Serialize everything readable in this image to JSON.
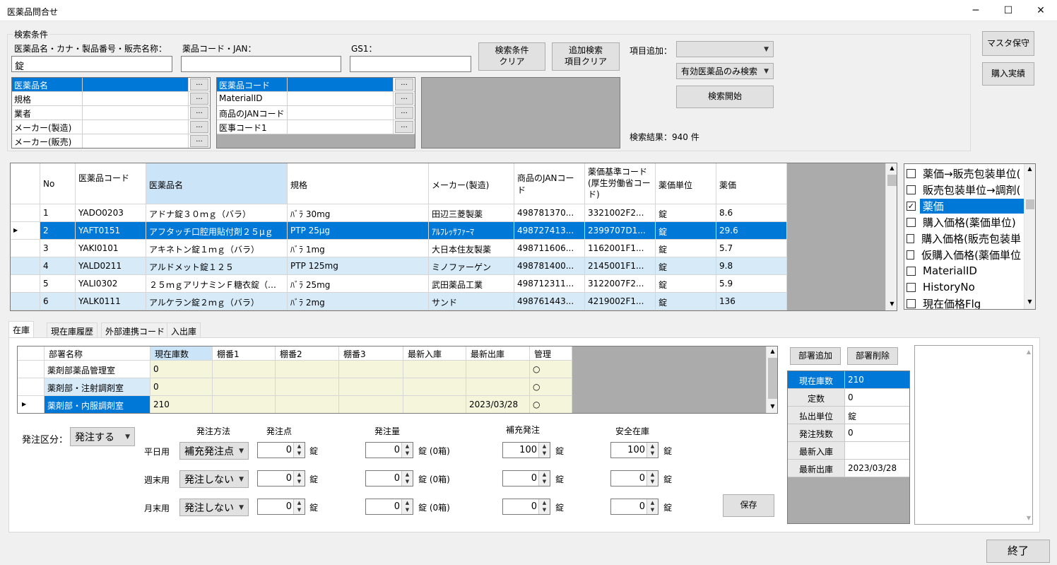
{
  "window": {
    "title": "医薬品問合せ",
    "minimize": "─",
    "maximize": "☐",
    "close": "✕"
  },
  "search": {
    "group_label": "検索条件",
    "name_label": "医薬品名・カナ・製品番号・販売名称：",
    "name_value": "錠",
    "code_label": "薬品コード・JAN：",
    "code_value": "",
    "gs1_label": "GS1：",
    "gs1_value": "",
    "clear_btn": [
      "検索条件",
      "クリア"
    ],
    "add_clear_btn": [
      "追加検索",
      "項目クリア"
    ],
    "add_item_label": "項目追加：",
    "add_item_value": "",
    "filter_value": "有効医薬品のみ検索",
    "start_btn": "検索開始",
    "result_text": "検索結果：940 件",
    "list1": [
      "医薬品名",
      "規格",
      "業者",
      "メーカー(製造)",
      "メーカー(販売)"
    ],
    "list2": [
      "医薬品コード",
      "MaterialID",
      "商品のJANコード",
      "医事コード1"
    ],
    "ellipsis": "..."
  },
  "side_buttons": {
    "master": "マスタ保守",
    "purchase": "購入実績"
  },
  "drug_grid": {
    "headers": [
      "No",
      "医薬品コード",
      "医薬品名",
      "規格",
      "メーカー(製造)",
      "商品のJANコード",
      "薬価基準コード(厚生労働省コード)",
      "薬価単位",
      "薬価"
    ],
    "rows": [
      [
        "1",
        "YADO0203",
        "アドナ錠３０ｍｇ（バラ）",
        "ﾊﾞﾗ 30mg",
        "田辺三菱製薬",
        "498781370...",
        "3321002F2...",
        "錠",
        "8.6"
      ],
      [
        "2",
        "YAFT0151",
        "アフタッチ口腔用貼付剤２５μｇ",
        "PTP 25μg",
        "ｱﾙﾌﾚｯｻﾌｧｰﾏ",
        "498727413...",
        "2399707D1...",
        "錠",
        "29.6"
      ],
      [
        "3",
        "YAKI0101",
        "アキネトン錠１ｍｇ（バラ）",
        "ﾊﾞﾗ 1mg",
        "大日本住友製薬",
        "498711606...",
        "1162001F1...",
        "錠",
        "5.7"
      ],
      [
        "4",
        "YALD0211",
        "アルドメット錠１２５",
        "PTP 125mg",
        "ミノファーゲン",
        "498781400...",
        "2145001F1...",
        "錠",
        "9.8"
      ],
      [
        "5",
        "YALI0302",
        "２５ｍｇアリナミンＦ糖衣錠（バ...",
        "ﾊﾞﾗ 25mg",
        "武田薬品工業",
        "498712311...",
        "3122007F2...",
        "錠",
        "5.9"
      ],
      [
        "6",
        "YALK0111",
        "アルケラン錠２ｍｇ（バラ）",
        "ﾊﾞﾗ 2mg",
        "サンド",
        "498761443...",
        "4219002F1...",
        "錠",
        "136"
      ]
    ]
  },
  "column_checklist": [
    {
      "label": "薬価→販売包装単位(",
      "checked": false
    },
    {
      "label": "販売包装単位→調剤(",
      "checked": false
    },
    {
      "label": "薬価",
      "checked": true
    },
    {
      "label": "購入価格(薬価単位)",
      "checked": false
    },
    {
      "label": "購入価格(販売包装単",
      "checked": false
    },
    {
      "label": "仮購入価格(薬価単位",
      "checked": false
    },
    {
      "label": "MaterialID",
      "checked": false
    },
    {
      "label": "HistoryNo",
      "checked": false
    },
    {
      "label": "現在価格Flg",
      "checked": false
    }
  ],
  "tabs": [
    "在庫",
    "現在庫履歴",
    "外部連携コード",
    "入出庫"
  ],
  "stock_grid": {
    "headers": [
      "部署名称",
      "現在庫数",
      "棚番1",
      "棚番2",
      "棚番3",
      "最新入庫",
      "最新出庫",
      "管理"
    ],
    "rows": [
      [
        "薬剤部薬品管理室",
        "0",
        "",
        "",
        "",
        "",
        "",
        "○"
      ],
      [
        "薬剤部・注射調剤室",
        "0",
        "",
        "",
        "",
        "",
        "",
        "○"
      ],
      [
        "薬剤部・内服調剤室",
        "210",
        "",
        "",
        "",
        "",
        "2023/03/28",
        "○"
      ]
    ]
  },
  "dept_buttons": {
    "add": "部署追加",
    "remove": "部署削除"
  },
  "detail": [
    [
      "現在庫数",
      "210"
    ],
    [
      "定数",
      "0"
    ],
    [
      "払出単位",
      "錠"
    ],
    [
      "発注残数",
      "0"
    ],
    [
      "最新入庫",
      ""
    ],
    [
      "最新出庫",
      "2023/03/28"
    ]
  ],
  "order": {
    "kubun_label": "発注区分：",
    "kubun_value": "発注する",
    "headers": {
      "method": "発注方法",
      "point": "発注点",
      "qty": "発注量",
      "replenish": "補充発注",
      "safety": "安全在庫"
    },
    "rows": [
      {
        "label": "平日用",
        "method": "補充発注点",
        "point": "0",
        "qty": "0",
        "replenish": "100",
        "safety": "100"
      },
      {
        "label": "週末用",
        "method": "発注しない",
        "point": "0",
        "qty": "0",
        "replenish": "0",
        "safety": "0"
      },
      {
        "label": "月末用",
        "method": "発注しない",
        "point": "0",
        "qty": "0",
        "replenish": "0",
        "safety": "0"
      }
    ],
    "unit": "錠",
    "qty_unit": "錠 (0箱)",
    "save_btn": "保存"
  },
  "exit_btn": "終了"
}
